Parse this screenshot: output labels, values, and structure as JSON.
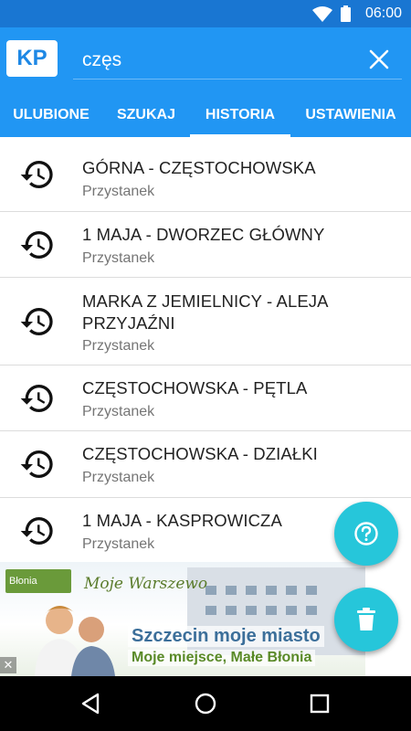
{
  "status": {
    "time": "06:00"
  },
  "header": {
    "logo": "KP",
    "search": {
      "value": "częs",
      "placeholder": ""
    }
  },
  "tabs": [
    {
      "label": "ULUBIONE",
      "active": false
    },
    {
      "label": "SZUKAJ",
      "active": false
    },
    {
      "label": "HISTORIA",
      "active": true
    },
    {
      "label": "USTAWIENIA",
      "active": false
    }
  ],
  "history": [
    {
      "title": "GÓRNA - CZĘSTOCHOWSKA",
      "type": "Przystanek"
    },
    {
      "title": "1 MAJA - DWORZEC GŁÓWNY",
      "type": "Przystanek"
    },
    {
      "title": "MARKA Z JEMIELNICY - ALEJA PRZYJAŹNI",
      "type": "Przystanek"
    },
    {
      "title": "CZĘSTOCHOWSKA - PĘTLA",
      "type": "Przystanek"
    },
    {
      "title": "CZĘSTOCHOWSKA - DZIAŁKI",
      "type": "Przystanek"
    },
    {
      "title": "1 MAJA - KASPROWICZA",
      "type": "Przystanek"
    }
  ],
  "ad": {
    "brand": "Błonia",
    "script": "Moje Warszewo",
    "line1": "Szczecin moje miasto",
    "line2": "Moje miejsce, Małe Błonia",
    "close": "✕"
  },
  "icons": {
    "history": "history-icon",
    "help": "help-icon",
    "delete": "trash-icon",
    "clear": "close-icon"
  },
  "colors": {
    "appbar": "#2196f3",
    "statusbar": "#1976d2",
    "fab": "#26c6da"
  }
}
